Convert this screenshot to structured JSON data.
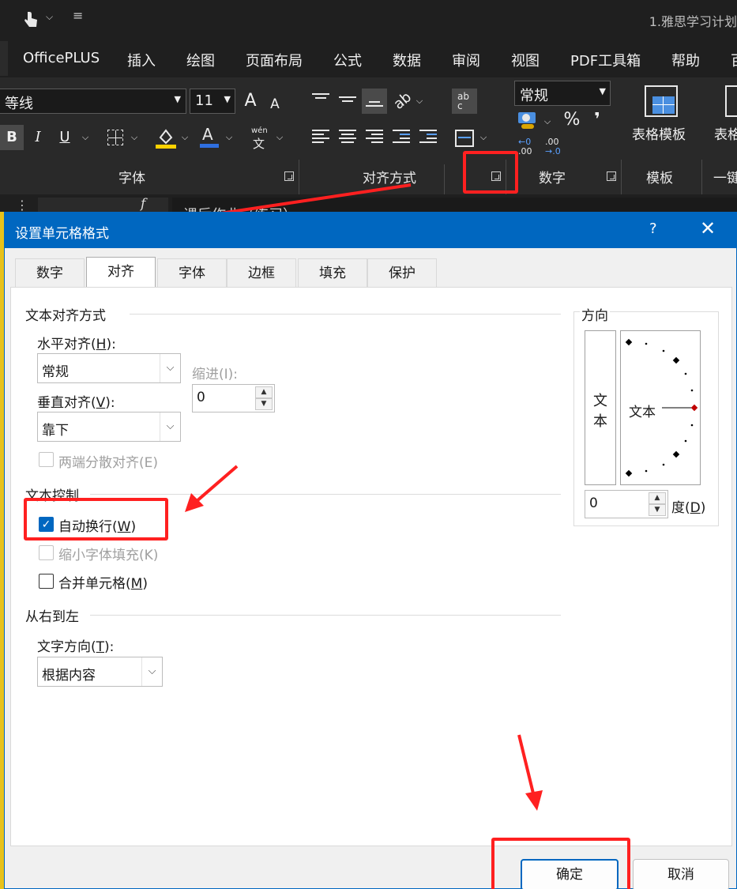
{
  "window": {
    "title": "1.雅思学习计划"
  },
  "menu": [
    "OfficePLUS",
    "插入",
    "绘图",
    "页面布局",
    "公式",
    "数据",
    "审阅",
    "视图",
    "PDF工具箱",
    "帮助",
    "百"
  ],
  "ribbon": {
    "font_name": "等线",
    "font_size": "11",
    "grow_font": "A",
    "shrink_font": "A",
    "bold": "B",
    "italic": "I",
    "underline": "U",
    "phonetic_top": "wén",
    "phonetic_bottom": "文",
    "number_format": "常规",
    "percent": "%",
    "comma": "❜",
    "dec_increase_top": "←0",
    "dec_increase_bottom": ".00",
    "dec_decrease_top": ".00",
    "dec_decrease_bottom": "→.0",
    "wrap_icon_text": "ab c",
    "template_button": "表格模板",
    "template_button_2": "表格",
    "groups": {
      "font": "字体",
      "alignment": "对齐方式",
      "number": "数字",
      "template": "模板",
      "onekey": "一键"
    }
  },
  "formula_bar": {
    "cell_text": "课后作业（练习）",
    "fx": "f"
  },
  "dialog": {
    "title": "设置单元格格式",
    "help": "?",
    "close": "✕",
    "tabs": [
      "数字",
      "对齐",
      "字体",
      "边框",
      "填充",
      "保护"
    ],
    "active_tab": "对齐",
    "text_alignment": {
      "section": "文本对齐方式",
      "horizontal_label": "水平对齐(",
      "horizontal_key": "H",
      "horizontal_suffix": "):",
      "horizontal_value": "常规",
      "indent_label": "缩进(I):",
      "indent_value": "0",
      "vertical_label": "垂直对齐(",
      "vertical_key": "V",
      "vertical_suffix": "):",
      "vertical_value": "靠下",
      "distributed_label": "两端分散对齐(E)"
    },
    "text_control": {
      "section": "文本控制",
      "wrap_text_prefix": "自动换行(",
      "wrap_text_key": "W",
      "wrap_text_suffix": ")",
      "wrap_text_checked": true,
      "shrink_label": "缩小字体填充(K)",
      "merge_prefix": "合并单元格(",
      "merge_key": "M",
      "merge_suffix": ")"
    },
    "rtl": {
      "section": "从右到左",
      "direction_label_prefix": "文字方向(",
      "direction_key": "T",
      "direction_label_suffix": "):",
      "direction_value": "根据内容"
    },
    "orientation": {
      "section": "方向",
      "vertical_text_1": "文",
      "vertical_text_2": "本",
      "dial_text": "文本",
      "degrees_value": "0",
      "degrees_label_prefix": "度(",
      "degrees_key": "D",
      "degrees_label_suffix": ")"
    },
    "ok": "确定",
    "cancel": "取消"
  },
  "colors": {
    "dialog_title_bar": "#0067c0",
    "annotation": "#ff2020",
    "ribbon": "#292929"
  }
}
